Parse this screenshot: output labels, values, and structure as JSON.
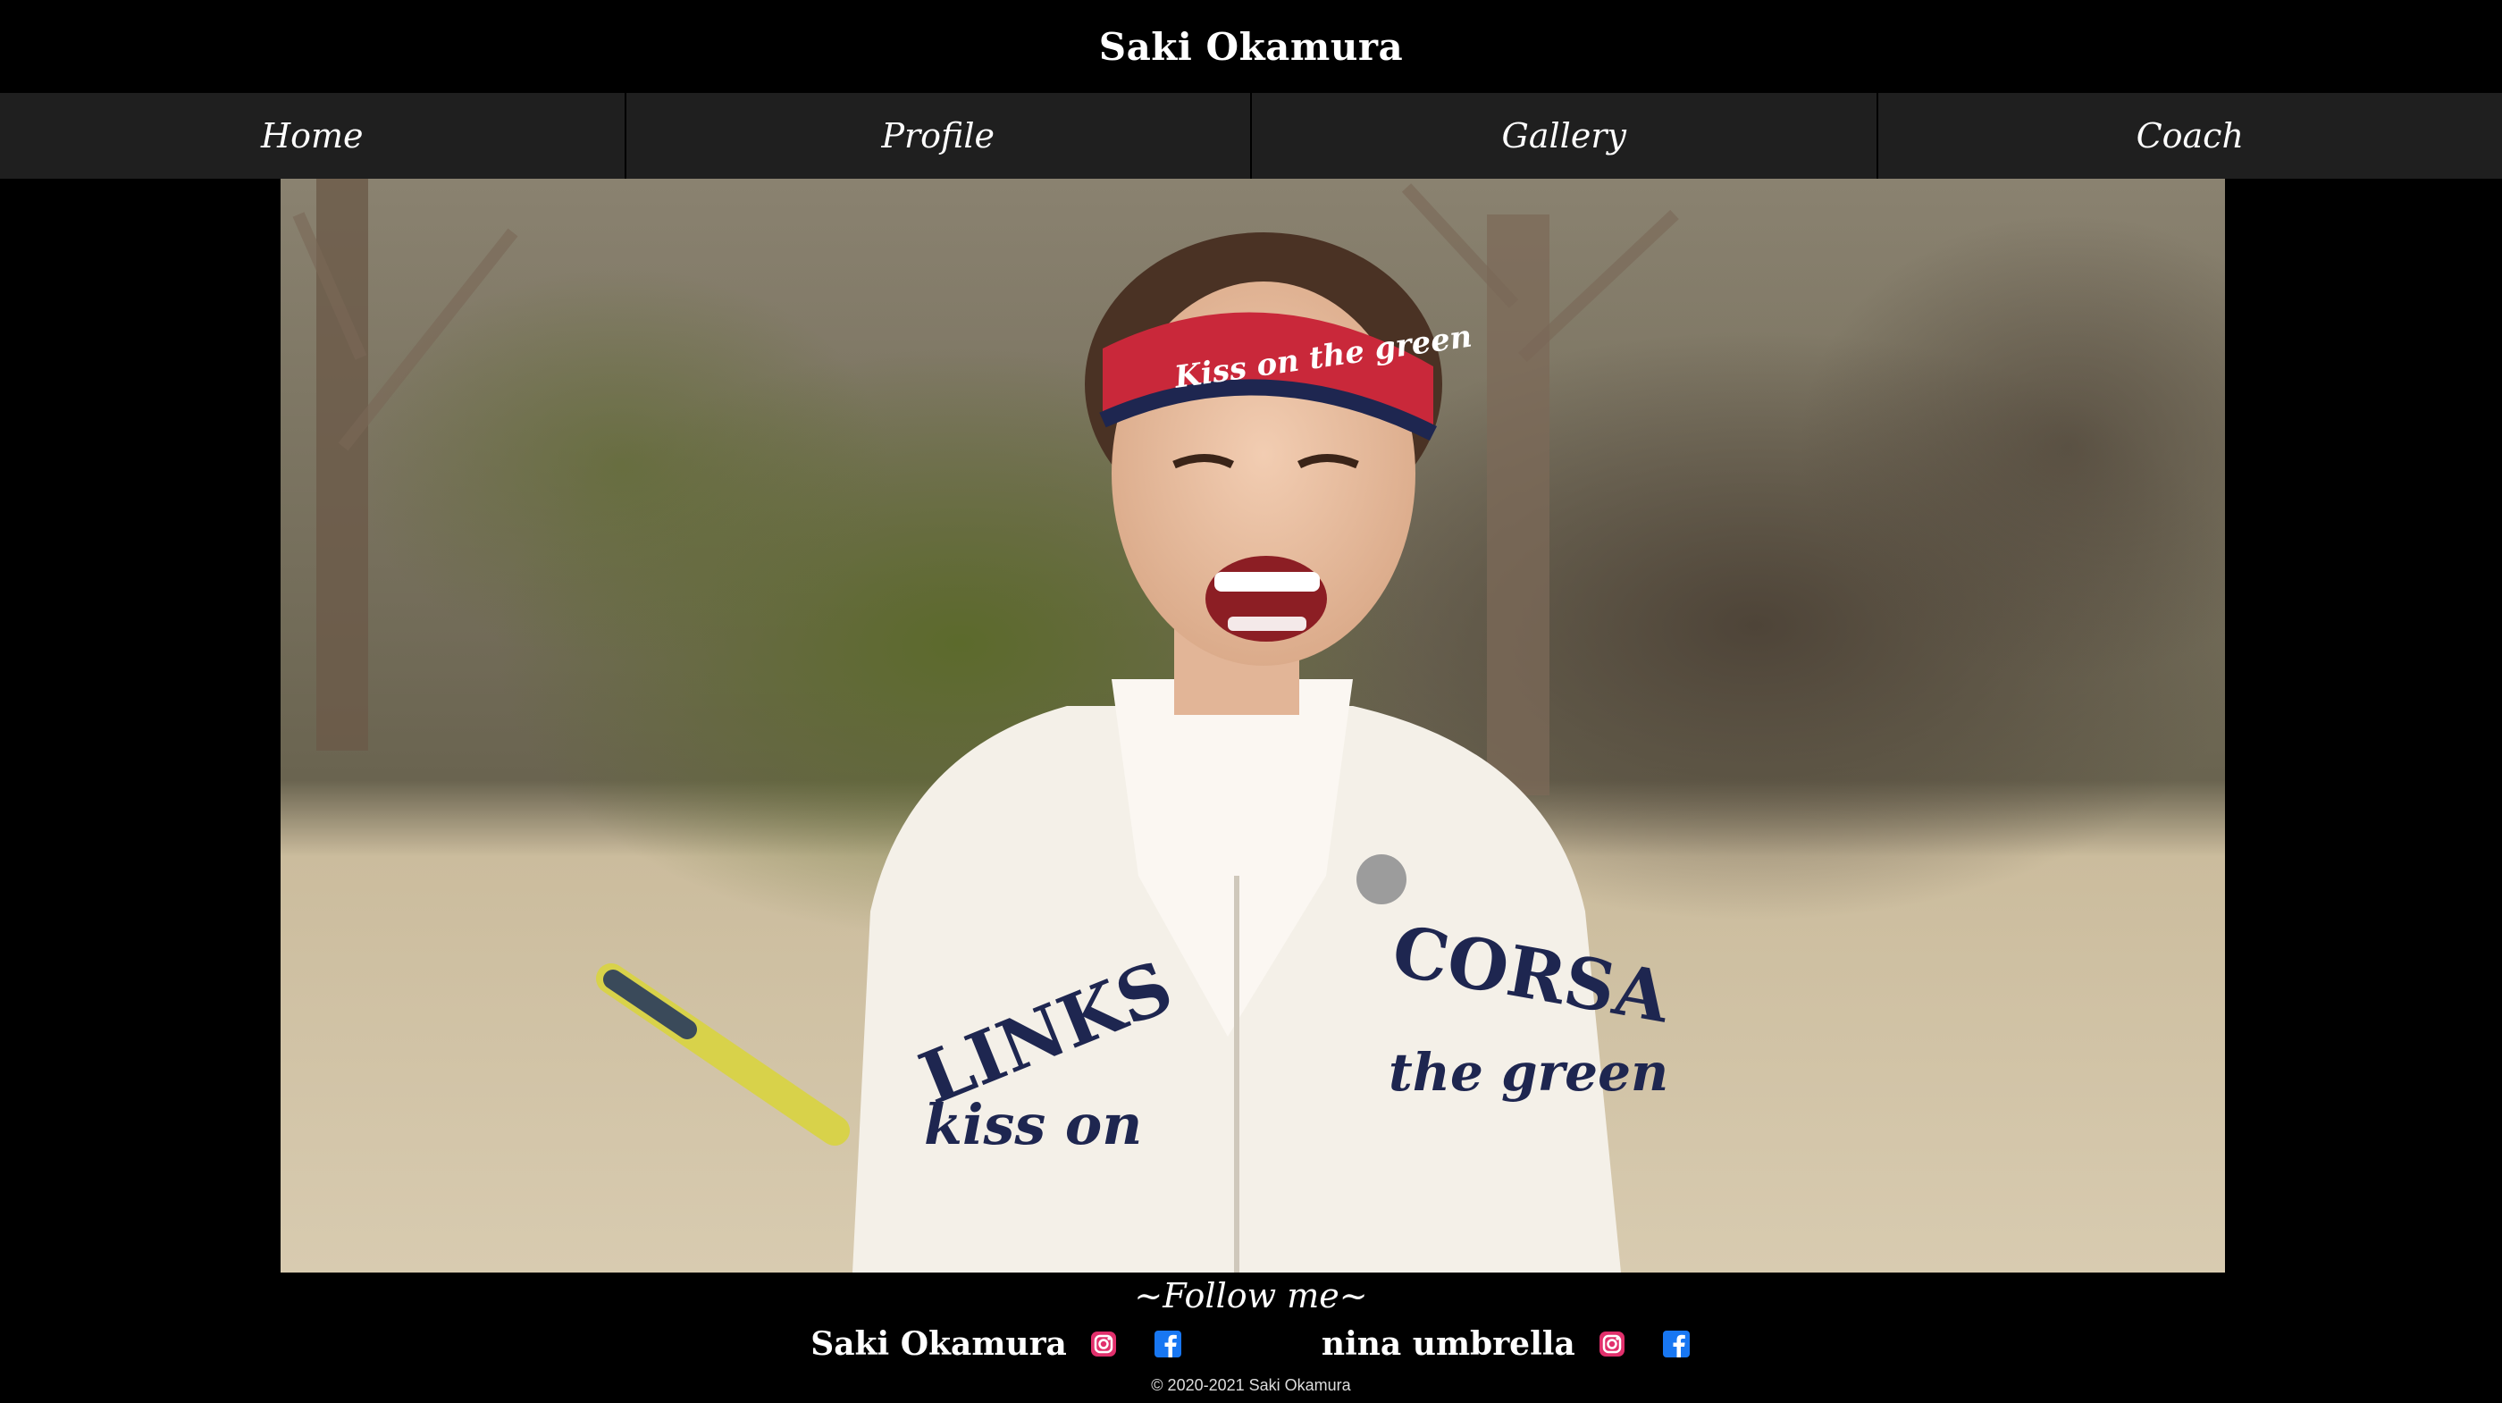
{
  "header": {
    "title": "Saki Okamura"
  },
  "nav": [
    {
      "label": "Home"
    },
    {
      "label": "Profile"
    },
    {
      "label": "Gallery"
    },
    {
      "label": "Coach"
    }
  ],
  "hero": {
    "visor_text": "Kiss on the green",
    "jacket_text_1": "LINKS",
    "jacket_text_2": "CORSA",
    "jacket_text_3": "kiss on",
    "jacket_text_4": "the green"
  },
  "footer": {
    "follow_label": "~Follow me~",
    "accounts": [
      {
        "name": "Saki Okamura",
        "icons": [
          "instagram-icon",
          "facebook-icon"
        ]
      },
      {
        "name": "nina umbrella",
        "icons": [
          "instagram-icon",
          "facebook-icon"
        ]
      }
    ],
    "copyright": "© 2020-2021 Saki Okamura"
  },
  "colors": {
    "background": "#000000",
    "nav_bg": "#1f1f1f",
    "instagram": "#e1306c",
    "facebook": "#1877f2"
  }
}
